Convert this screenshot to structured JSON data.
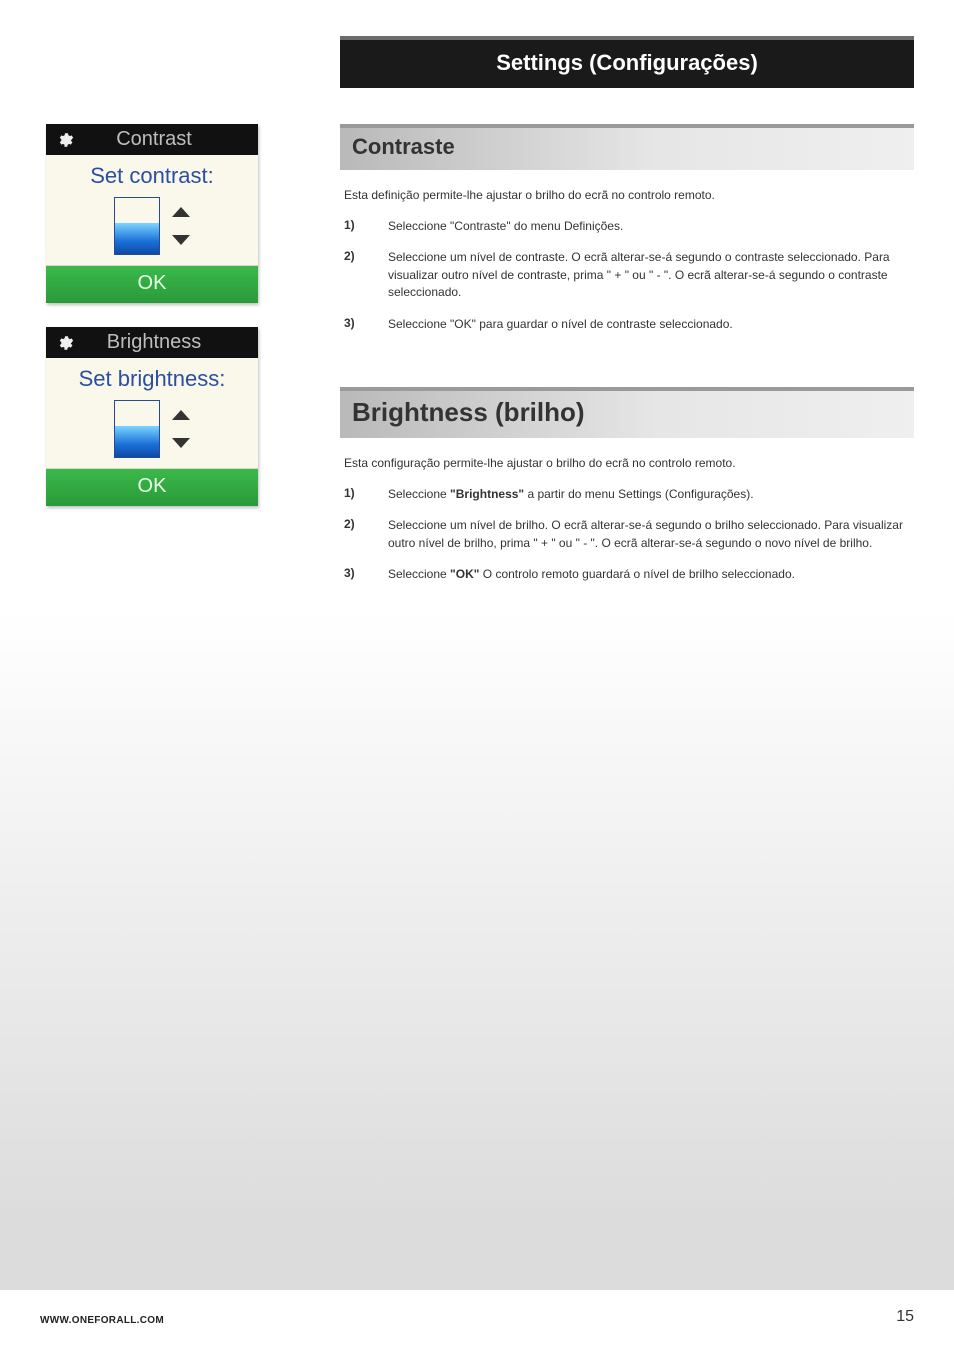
{
  "banner": {
    "title": "Settings (Configurações)"
  },
  "devices": {
    "contrast": {
      "header": "Contrast",
      "body_label": "Set contrast:",
      "ok": "OK"
    },
    "brightness": {
      "header": "Brightness",
      "body_label": "Set brightness:",
      "ok": "OK"
    }
  },
  "sections": {
    "contraste": {
      "title": "Contraste",
      "intro": "Esta definição permite-lhe ajustar o brilho do ecrã no controlo remoto.",
      "steps": [
        {
          "num": "1)",
          "text": "Seleccione \"Contraste\" do menu Definições."
        },
        {
          "num": "2)",
          "text": "Seleccione um nível de contraste. O ecrã alterar-se-á segundo o contraste seleccionado. Para visualizar outro nível de contraste, prima \" + \" ou \" - \". O ecrã alterar-se-á segundo o contraste seleccionado."
        },
        {
          "num": "3)",
          "text": "Seleccione \"OK\" para guardar o nível de contraste seleccionado."
        }
      ]
    },
    "brightness": {
      "title": "Brightness (brilho)",
      "intro": "Esta configuração permite-lhe ajustar o brilho do ecrã no controlo remoto.",
      "steps": [
        {
          "num": "1)",
          "pre": "Seleccione ",
          "bold": "\"Brightness\"",
          "post": " a partir do menu Settings (Configurações)."
        },
        {
          "num": "2)",
          "text": "Seleccione um nível de brilho. O ecrã alterar-se-á segundo o brilho seleccionado. Para visualizar outro nível de brilho, prima \" + \" ou \" - \". O ecrã alterar-se-á segundo o novo nível de brilho."
        },
        {
          "num": "3)",
          "pre": "Seleccione ",
          "bold": "\"OK\"",
          "post": " O controlo remoto guardará o nível de brilho seleccionado."
        }
      ]
    }
  },
  "footer": {
    "url": "WWW.ONEFORALL.COM",
    "page": "15"
  }
}
